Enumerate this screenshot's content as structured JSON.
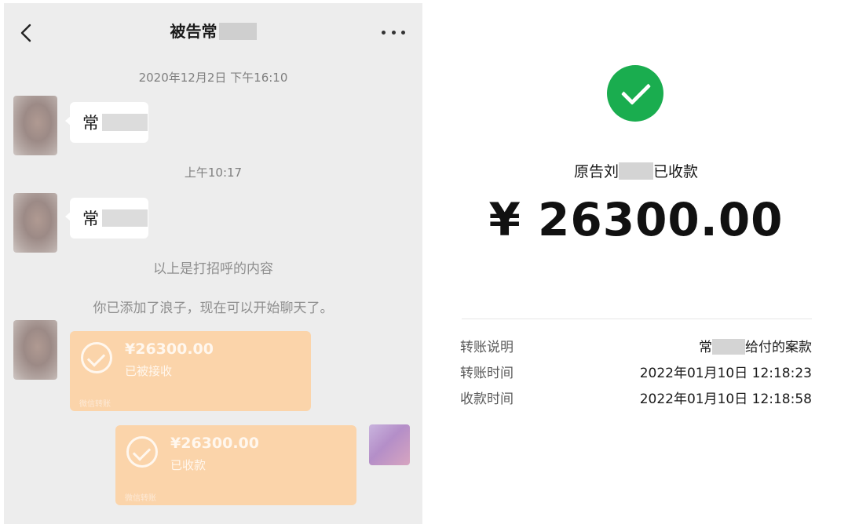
{
  "chat": {
    "title": "被告常",
    "messages": [
      {
        "type": "timestamp",
        "text": "2020年12月2日 下午16:10"
      },
      {
        "type": "text",
        "from": "other",
        "text": "常"
      },
      {
        "type": "timestamp",
        "text": "上午10:17"
      },
      {
        "type": "text",
        "from": "other",
        "text": "常"
      },
      {
        "type": "system",
        "text": "以上是打招呼的内容"
      },
      {
        "type": "system",
        "text": "你已添加了浪子，现在可以开始聊天了。"
      },
      {
        "type": "transfer",
        "from": "other",
        "amount": "¥26300.00",
        "status": "已被接收",
        "footer": "微信转账"
      },
      {
        "type": "transfer",
        "from": "self",
        "amount": "¥26300.00",
        "status": "已收款",
        "footer": "微信转账"
      }
    ]
  },
  "receipt": {
    "status_prefix": "原告刘",
    "status_suffix": "已收款",
    "amount": "¥ 26300.00",
    "rows": [
      {
        "label": "转账说明",
        "value_prefix": "常",
        "value_suffix": "给付的案款"
      },
      {
        "label": "转账时间",
        "value": "2022年01月10日 12:18:23"
      },
      {
        "label": "收款时间",
        "value": "2022年01月10日 12:18:58"
      }
    ]
  },
  "icons": [
    "chevron-left-icon",
    "more-dots-icon",
    "check-circle-icon",
    "success-check-icon"
  ],
  "colors": {
    "success": "#1aad4f",
    "transfer_bubble": "#fbd4aa",
    "chat_bg": "#ededed"
  }
}
